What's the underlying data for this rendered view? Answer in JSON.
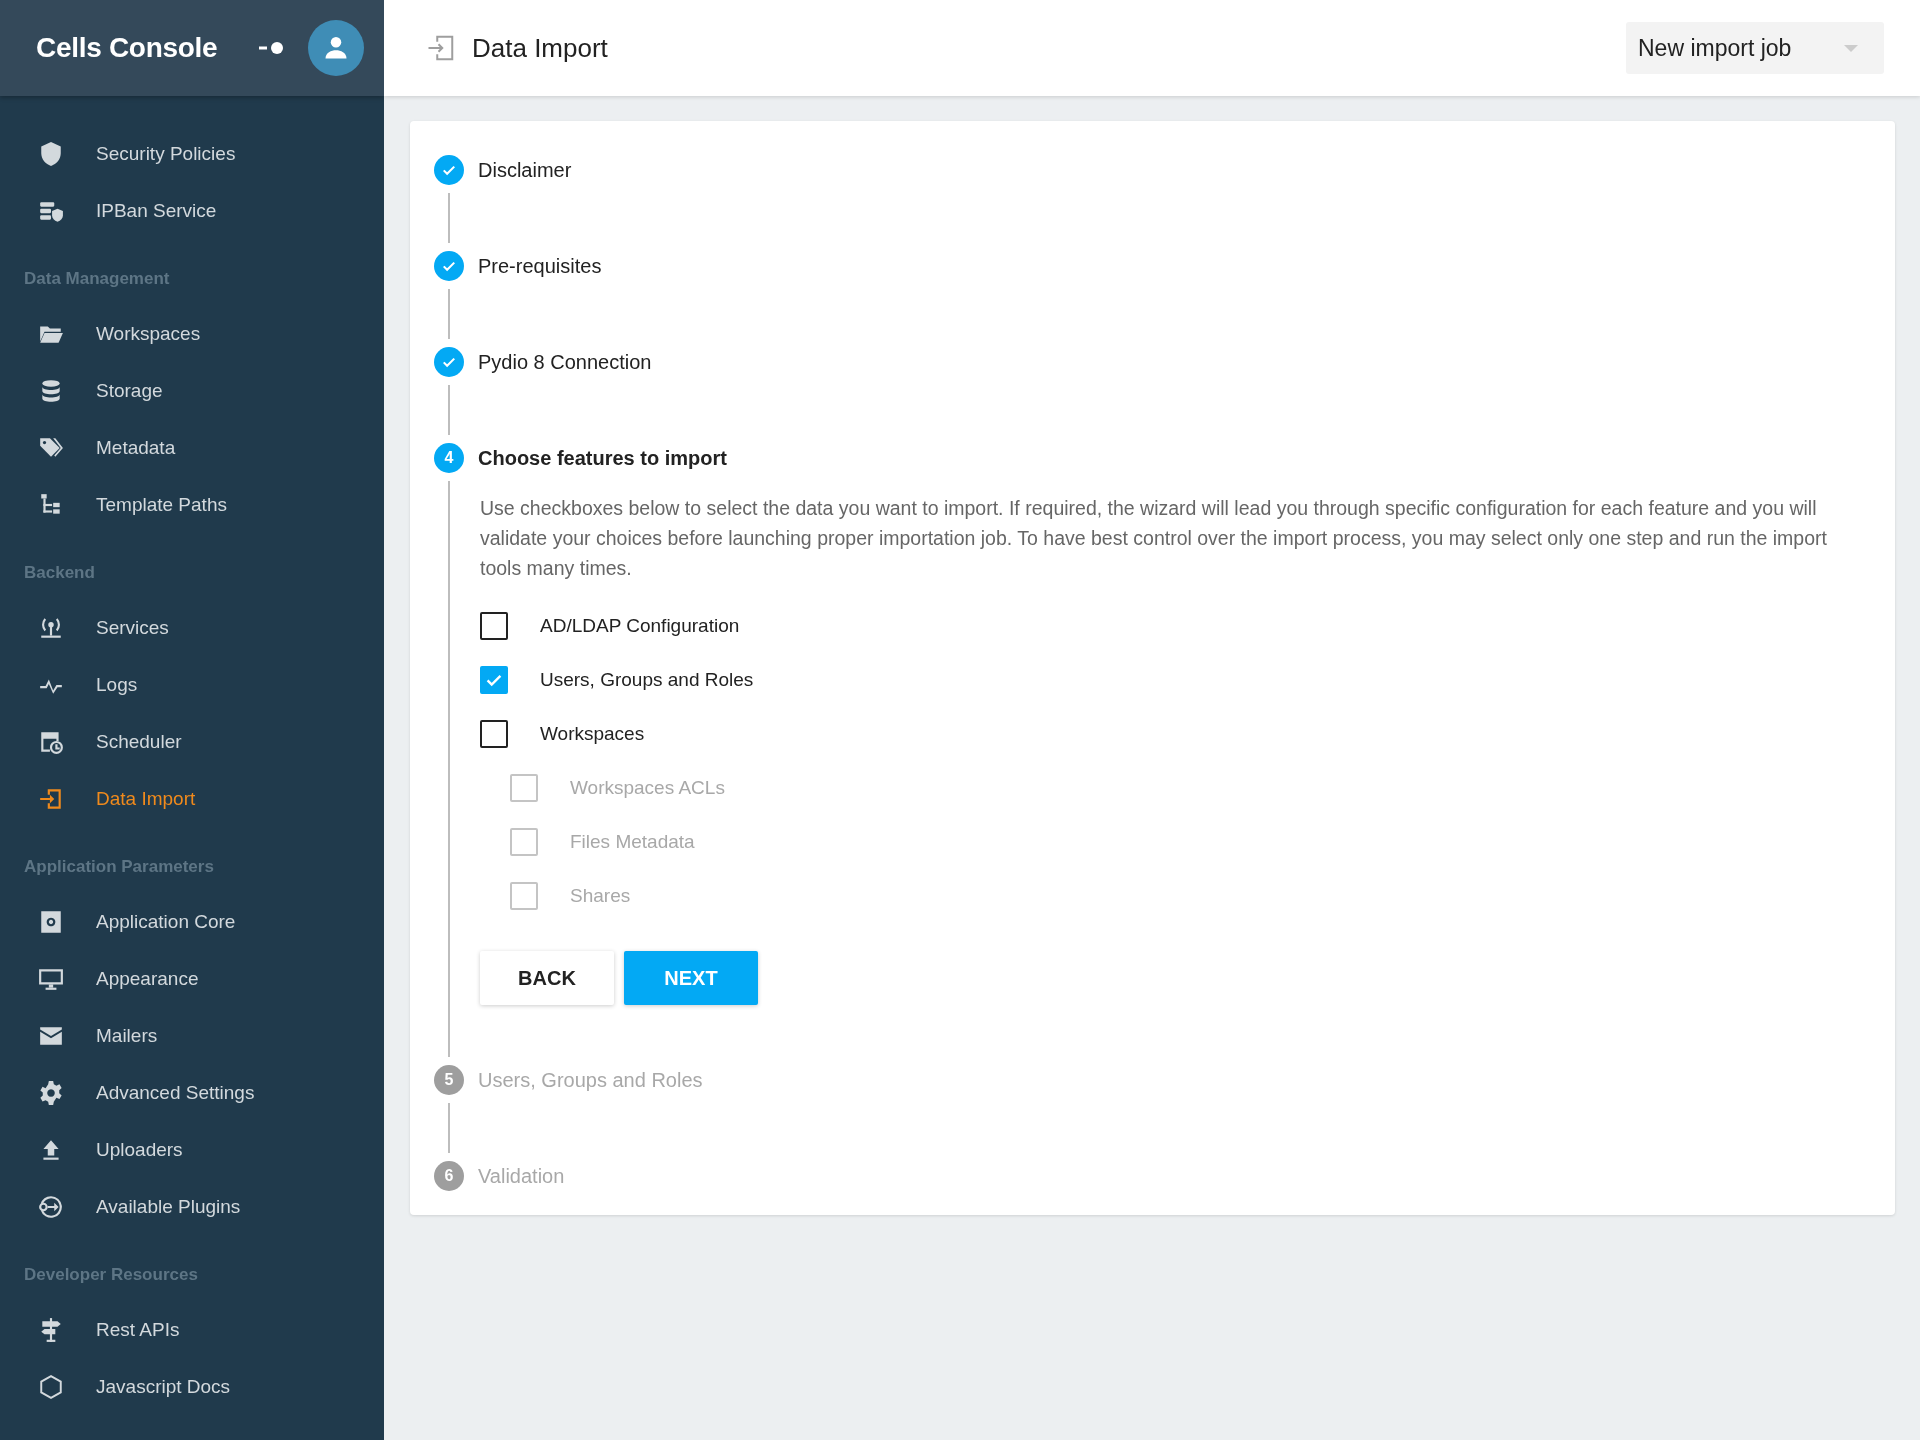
{
  "sidebar": {
    "title": "Cells Console",
    "sections": [
      {
        "items": [
          {
            "label": "Security Policies",
            "selected": false
          },
          {
            "label": "IPBan Service",
            "selected": false
          }
        ]
      },
      {
        "title": "Data Management",
        "items": [
          {
            "label": "Workspaces",
            "selected": false
          },
          {
            "label": "Storage",
            "selected": false
          },
          {
            "label": "Metadata",
            "selected": false
          },
          {
            "label": "Template Paths",
            "selected": false
          }
        ]
      },
      {
        "title": "Backend",
        "items": [
          {
            "label": "Services",
            "selected": false
          },
          {
            "label": "Logs",
            "selected": false
          },
          {
            "label": "Scheduler",
            "selected": false
          },
          {
            "label": "Data Import",
            "selected": true
          }
        ]
      },
      {
        "title": "Application Parameters",
        "items": [
          {
            "label": "Application Core",
            "selected": false
          },
          {
            "label": "Appearance",
            "selected": false
          },
          {
            "label": "Mailers",
            "selected": false
          },
          {
            "label": "Advanced Settings",
            "selected": false
          },
          {
            "label": "Uploaders",
            "selected": false
          },
          {
            "label": "Available Plugins",
            "selected": false
          }
        ]
      },
      {
        "title": "Developer Resources",
        "items": [
          {
            "label": "Rest APIs",
            "selected": false
          },
          {
            "label": "Javascript Docs",
            "selected": false
          }
        ]
      }
    ]
  },
  "header": {
    "title": "Data Import",
    "job_select": {
      "value": "New import job"
    }
  },
  "steps": [
    {
      "label": "Disclaimer",
      "completed": true,
      "selected": false
    },
    {
      "label": "Pre-requisites",
      "completed": true,
      "selected": false
    },
    {
      "label": "Pydio 8 Connection",
      "completed": true,
      "selected": false
    },
    {
      "label": "Choose features to import",
      "completed": false,
      "selected": true,
      "number": "4",
      "description": "Use checkboxes below to select the data you want to import. If required, the wizard will lead you through specific configuration for each feature and you will validate your choices before launching proper importation job. To have best control over the import process, you may select only one step and run the import tools many times.",
      "features": [
        {
          "label": "AD/LDAP Configuration",
          "checked": false,
          "disabled": false
        },
        {
          "label": "Users, Groups and Roles",
          "checked": true,
          "disabled": false
        },
        {
          "label": "Workspaces",
          "checked": false,
          "disabled": false,
          "children": [
            {
              "label": "Workspaces ACLs",
              "checked": false,
              "disabled": true
            },
            {
              "label": "Files Metadata",
              "checked": false,
              "disabled": true
            },
            {
              "label": "Shares",
              "checked": false,
              "disabled": true
            }
          ]
        }
      ],
      "buttons": [
        {
          "label": "BACK",
          "kind": "secondary"
        },
        {
          "label": "NEXT",
          "kind": "primary"
        }
      ]
    },
    {
      "label": "Users, Groups and Roles",
      "completed": false,
      "selected": false,
      "number": "5"
    },
    {
      "label": "Validation",
      "completed": false,
      "selected": false,
      "number": "6"
    }
  ]
}
